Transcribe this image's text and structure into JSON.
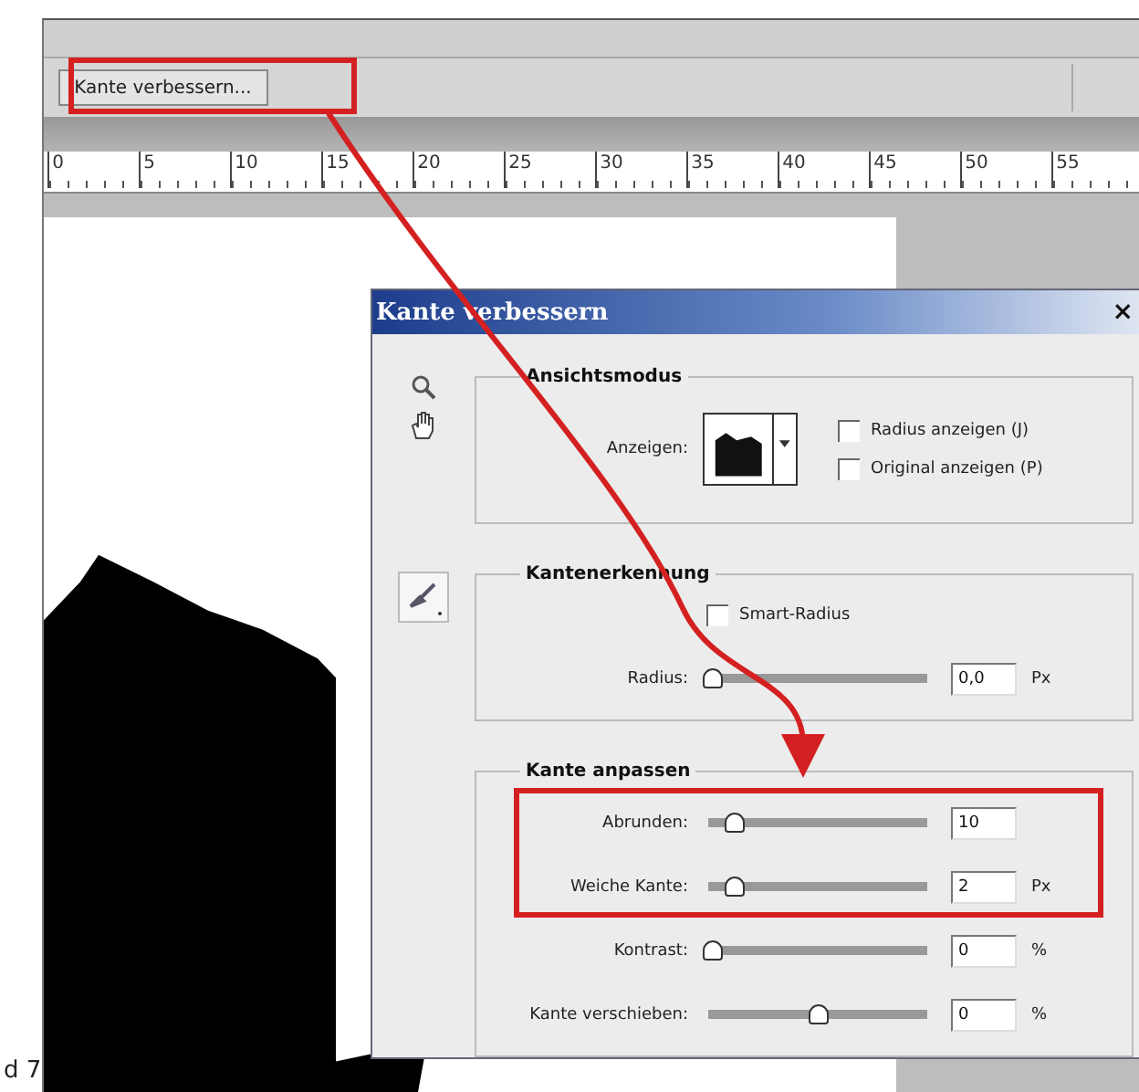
{
  "caption": "d 7",
  "options_bar": {
    "button": "Kante verbessern..."
  },
  "ruler": {
    "ticks": [
      "0",
      "5",
      "10",
      "15",
      "20",
      "25",
      "30",
      "35",
      "40",
      "45",
      "50",
      "55"
    ]
  },
  "dialog": {
    "title": "Kante verbessern",
    "close": "×",
    "view_mode": {
      "title": "Ansichtsmodus",
      "label": "Anzeigen:",
      "checkboxes": [
        {
          "label": "Radius anzeigen (J)",
          "checked": false
        },
        {
          "label": "Original anzeigen (P)",
          "checked": false
        }
      ]
    },
    "edge_detection": {
      "title": "Kantenerkennung",
      "smart_radius": {
        "label": "Smart-Radius",
        "checked": false
      },
      "radius": {
        "label": "Radius:",
        "level": 0,
        "value": "0,0",
        "unit": "Px"
      }
    },
    "adjust_edge": {
      "title": "Kante anpassen",
      "sliders": [
        {
          "label": "Abrunden:",
          "level": 0.1,
          "value": "10"
        },
        {
          "label": "Weiche Kante:",
          "level": 0.1,
          "value": "2",
          "unit": "Px"
        },
        {
          "label": "Kontrast:",
          "level": 0,
          "value": "0",
          "unit": "%"
        },
        {
          "label": "Kante verschieben:",
          "level": 0.5,
          "value": "0",
          "unit": "%"
        }
      ]
    }
  }
}
